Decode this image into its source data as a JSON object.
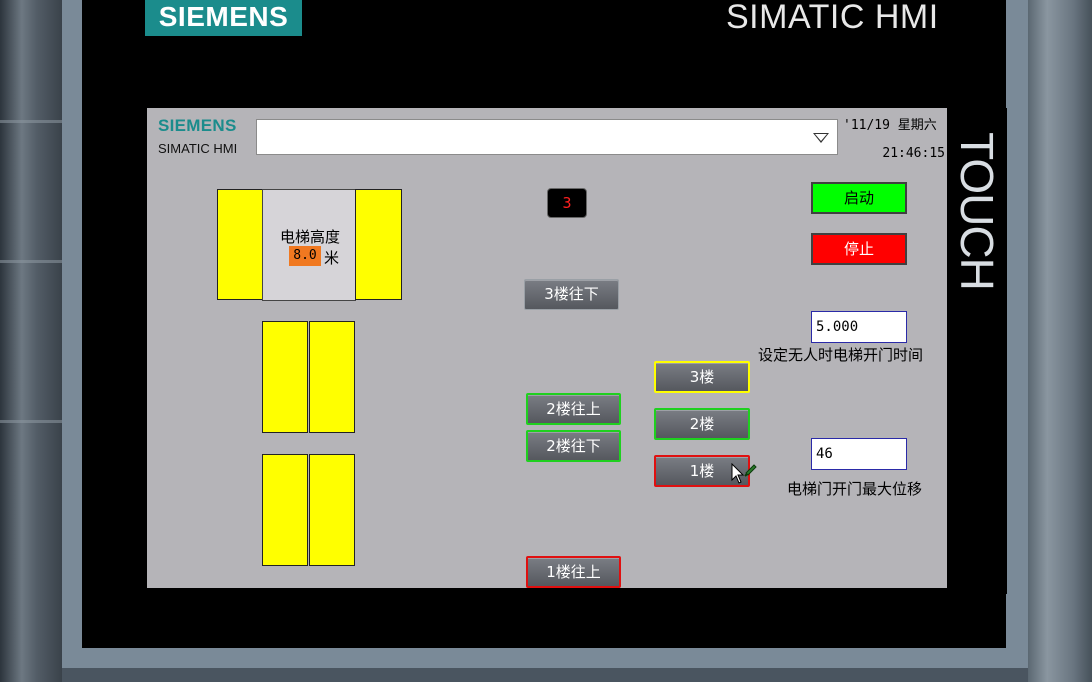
{
  "device": {
    "brand": "SIEMENS",
    "product": "SIMATIC HMI",
    "side_label": "TOUCH"
  },
  "header": {
    "brand": "SIEMENS",
    "product": "SIMATIC HMI",
    "alarm_window": "",
    "date": "'11/19 星期六",
    "time": "21:46:15"
  },
  "elevator": {
    "height_label": "电梯高度",
    "height_value": "8.0",
    "height_unit": "米",
    "floor_indicator": "3"
  },
  "call_buttons": {
    "floor3_down": "3楼往下",
    "floor2_up": "2楼往上",
    "floor2_down": "2楼往下",
    "floor1_up": "1楼往上"
  },
  "car_buttons": {
    "floor3": "3楼",
    "floor2": "2楼",
    "floor1": "1楼"
  },
  "controls": {
    "start": "启动",
    "stop": "停止"
  },
  "settings": {
    "door_open_time_value": "5.000",
    "door_open_time_label": "设定无人时电梯开门时间",
    "door_max_displacement_value": "46",
    "door_max_displacement_label": "电梯门开门最大位移"
  },
  "colors": {
    "door_yellow": "#ffff00",
    "start_green": "#00ff00",
    "stop_red": "#ff0000",
    "siemens_teal": "#1b8c8c",
    "height_value_orange": "#f07820"
  }
}
